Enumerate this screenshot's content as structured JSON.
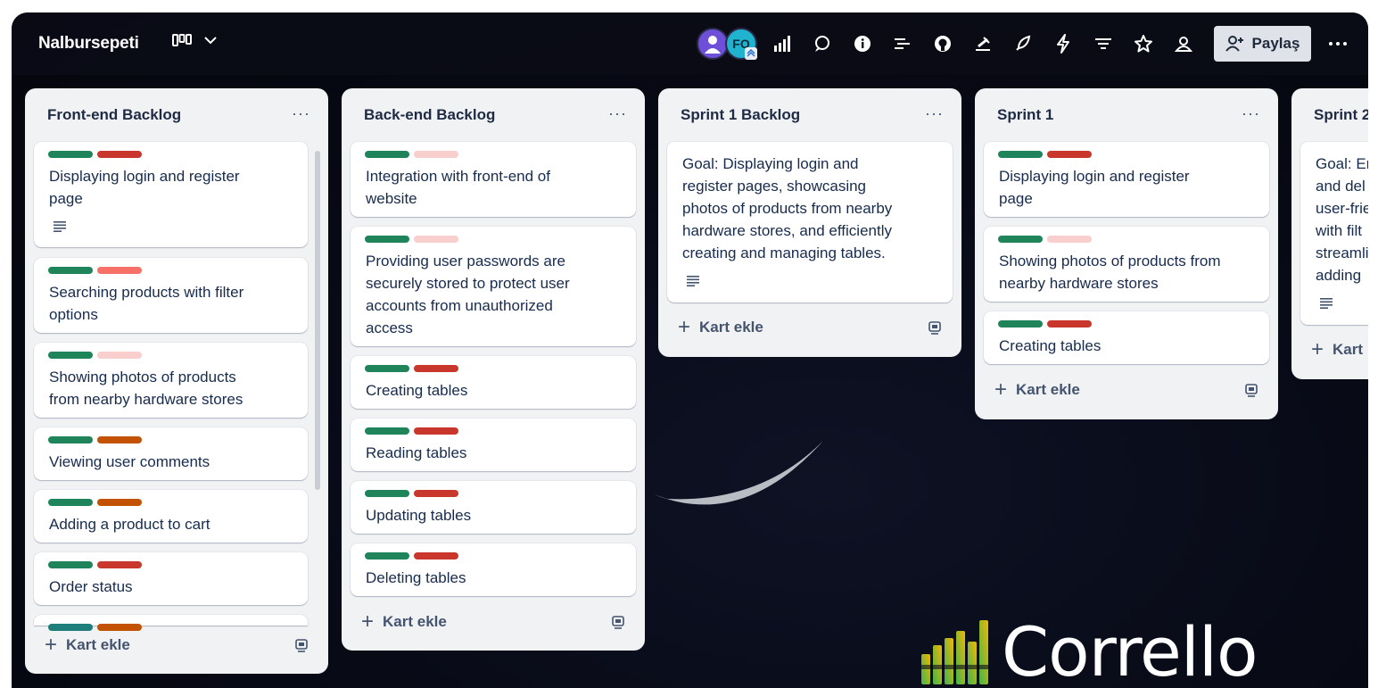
{
  "board": {
    "title": "Nalbursepeti"
  },
  "avatars": [
    {
      "initials": ""
    },
    {
      "initials": "FO"
    }
  ],
  "share": {
    "label": "Paylaş"
  },
  "colors": {
    "green": "#1f845a",
    "red": "#c9372c",
    "pink": "#f8cfcc",
    "salmon": "#f87168",
    "orange": "#c25100",
    "teal": "#1e7f7a"
  },
  "lists": [
    {
      "title": "Front-end Backlog",
      "cards": [
        {
          "text": [
            "Displaying login and register",
            "page"
          ],
          "labels": [
            "green",
            "red"
          ],
          "desc": true
        },
        {
          "text": [
            "Searching products with filter",
            "options"
          ],
          "labels": [
            "green",
            "salmon"
          ]
        },
        {
          "text": [
            "Showing photos of products",
            "from nearby hardware stores"
          ],
          "labels": [
            "green",
            "pink"
          ]
        },
        {
          "text": [
            "Viewing user comments"
          ],
          "labels": [
            "green",
            "orange"
          ]
        },
        {
          "text": [
            "Adding a product to cart"
          ],
          "labels": [
            "green",
            "orange"
          ]
        },
        {
          "text": [
            "Order status"
          ],
          "labels": [
            "green",
            "red"
          ]
        }
      ],
      "add_label": "Kart ekle"
    },
    {
      "title": "Back-end Backlog",
      "cards": [
        {
          "text": [
            "Integration with front-end of",
            "website"
          ],
          "labels": [
            "green",
            "pink"
          ]
        },
        {
          "text": [
            "Providing user passwords are",
            "securely stored to protect user",
            "accounts from unauthorized",
            "access"
          ],
          "labels": [
            "green",
            "pink"
          ]
        },
        {
          "text": [
            "Creating tables"
          ],
          "labels": [
            "green",
            "red"
          ]
        },
        {
          "text": [
            "Reading tables"
          ],
          "labels": [
            "green",
            "red"
          ]
        },
        {
          "text": [
            "Updating tables"
          ],
          "labels": [
            "green",
            "red"
          ]
        },
        {
          "text": [
            "Deleting tables"
          ],
          "labels": [
            "green",
            "red"
          ]
        }
      ],
      "add_label": "Kart ekle"
    },
    {
      "title": "Sprint 1 Backlog",
      "cards": [
        {
          "text": [
            "Goal: Displaying login and",
            "register pages, showcasing",
            "photos of products from nearby",
            "hardware stores, and efficiently",
            "creating and managing tables."
          ],
          "labels": [],
          "desc": true
        }
      ],
      "add_label": "Kart ekle"
    },
    {
      "title": "Sprint 1",
      "cards": [
        {
          "text": [
            "Displaying login and register",
            "page"
          ],
          "labels": [
            "green",
            "red"
          ]
        },
        {
          "text": [
            "Showing photos of products from",
            "nearby hardware stores"
          ],
          "labels": [
            "green",
            "pink"
          ]
        },
        {
          "text": [
            "Creating tables"
          ],
          "labels": [
            "green",
            "red"
          ]
        }
      ],
      "add_label": "Kart ekle"
    },
    {
      "title": "Sprint 2",
      "cards": [
        {
          "text": [
            "Goal: Er",
            "and del",
            "user-frie",
            "with filt",
            "streamli",
            "adding"
          ],
          "labels": [],
          "desc": true
        }
      ],
      "add_label": "Kart"
    }
  ],
  "logo": {
    "text": "Corrello"
  }
}
